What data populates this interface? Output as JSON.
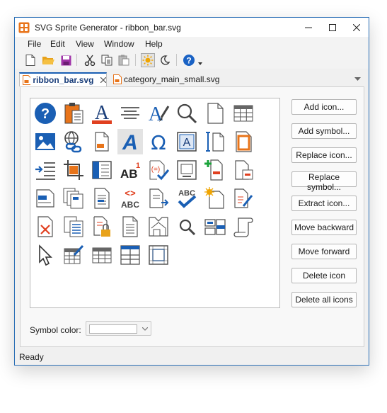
{
  "window": {
    "title": "SVG Sprite Generator - ribbon_bar.svg"
  },
  "menu": [
    "File",
    "Edit",
    "View",
    "Window",
    "Help"
  ],
  "toolbar": {
    "icons": [
      "new-file-icon",
      "open-folder-icon",
      "save-icon",
      "cut-icon",
      "copy-icon",
      "paste-icon",
      "light-theme-icon",
      "dark-theme-icon",
      "help-icon",
      "dropdown-arrow-icon"
    ],
    "light_theme_active": true
  },
  "tabs": [
    {
      "label": "ribbon_bar.svg",
      "active": true
    },
    {
      "label": "category_main_small.svg",
      "active": false
    }
  ],
  "icon_grid": {
    "selected_index": 11,
    "icons": [
      "help-icon",
      "clipboard-icon",
      "font-color-icon",
      "align-center-icon",
      "text-style-icon",
      "search-icon",
      "blank-page-icon",
      "table-icon",
      "image-icon",
      "hyperlink-icon",
      "page-highlight-icon",
      "italic-a-icon",
      "omega-symbol-icon",
      "text-box-icon",
      "line-spacing-icon",
      "page-border-icon",
      "indent-icon",
      "crop-icon",
      "sidebar-layout-icon",
      "superscript-icon",
      "formula-check-icon",
      "text-frame-icon",
      "insert-row-icon",
      "remove-page-icon",
      "caption-icon",
      "multi-page-icon",
      "page-lines-icon",
      "code-abc-icon",
      "move-page-icon",
      "spellcheck-icon",
      "new-page-sparkle-icon",
      "edit-page-icon",
      "delete-page-icon",
      "copy-pages-icon",
      "lock-page-icon",
      "document-icon",
      "fold-page-icon",
      "find-icon",
      "window-list-icon",
      "scroll-icon",
      "cursor-arrow-icon",
      "edit-table-icon",
      "plain-table-icon",
      "grid-table-icon",
      "frame-icon"
    ]
  },
  "buttons": [
    "Add icon...",
    "Add symbol...",
    "Replace icon...",
    "Replace symbol...",
    "Extract icon...",
    "Move backward",
    "Move forward",
    "Delete icon",
    "Delete all icons"
  ],
  "symbol_color": {
    "label": "Symbol color:",
    "value": "#ffffff"
  },
  "status": "Ready"
}
